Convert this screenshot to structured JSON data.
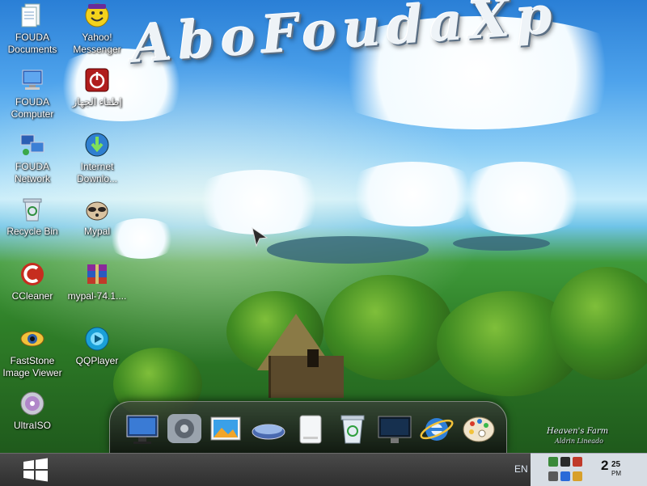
{
  "wallpaper": {
    "title": "AboFoudaXp",
    "signature_line1": "Heaven's Farm",
    "signature_line2": "Aldrin Lineado"
  },
  "desktop_icons": [
    {
      "label": "FOUDA Documents",
      "icon": "documents-icon"
    },
    {
      "label": "Yahoo! Messenger",
      "icon": "yahoo-messenger-icon"
    },
    {
      "label": "FOUDA Computer",
      "icon": "computer-icon"
    },
    {
      "label": "إطفاء الجهاز",
      "icon": "power-off-icon"
    },
    {
      "label": "FOUDA Network",
      "icon": "network-icon"
    },
    {
      "label": "Internet Downlo...",
      "icon": "internet-download-manager-icon"
    },
    {
      "label": "Recycle Bin",
      "icon": "recycle-bin-icon"
    },
    {
      "label": "Mypal",
      "icon": "mypal-raccoon-icon"
    },
    {
      "label": "CCleaner",
      "icon": "ccleaner-icon"
    },
    {
      "label": "mypal-74.1....",
      "icon": "winrar-archive-icon"
    },
    {
      "label": "FastStone Image Viewer",
      "icon": "faststone-eye-icon"
    },
    {
      "label": "QQPlayer",
      "icon": "qqplayer-icon"
    },
    {
      "label": "UltraISO",
      "icon": "ultraiso-disc-icon"
    }
  ],
  "dock": {
    "items": [
      "monitor-icon",
      "settings-gear-icon",
      "photo-gallery-icon",
      "scanner-icon",
      "drive-icon",
      "recycle-bin-icon",
      "display-icon",
      "internet-explorer-icon",
      "paint-palette-icon"
    ]
  },
  "taskbar": {
    "start_icon": "windows-logo-icon",
    "language": "EN",
    "clock_hour": "2",
    "clock_minute": "25",
    "clock_ampm": "PM"
  },
  "colors": {
    "taskbar": "#3a3a3a",
    "tray": "#d7dde4",
    "sky": "#4ea3ec",
    "grass": "#2f7f28"
  }
}
